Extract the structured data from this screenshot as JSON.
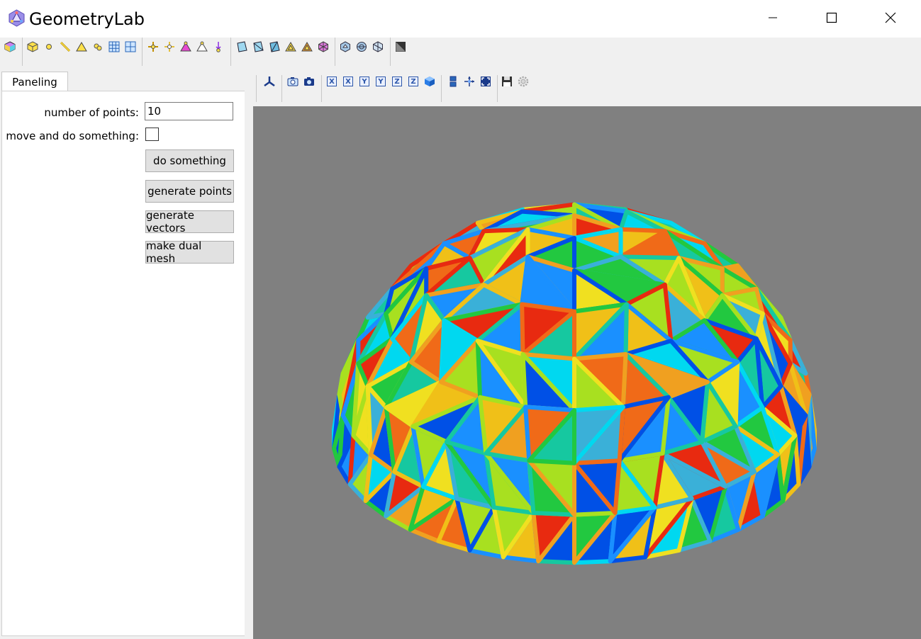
{
  "window": {
    "title": "GeometryLab",
    "controls": [
      "minimize",
      "maximize",
      "close"
    ]
  },
  "main_toolbar": {
    "groups": [
      [
        "cube-icon"
      ],
      [
        "box-icon",
        "point-icon",
        "line-icon",
        "triangle-icon",
        "circles-icon",
        "grid-icon",
        "quad-grid-icon"
      ],
      [
        "add-vertex-icon",
        "move-vertex-icon",
        "pick-triangle-icon",
        "outline-triangle-icon",
        "pin-down-icon"
      ],
      [
        "quad-face-icon",
        "quad-face-2-icon",
        "quad-face-3-icon",
        "tri-face-icon",
        "tri-face-2-icon",
        "hex-icon"
      ],
      [
        "mesh-sphere-icon",
        "mesh-sphere-2-icon",
        "mesh-sphere-3-icon"
      ],
      [
        "shading-toggle-icon"
      ]
    ]
  },
  "panel": {
    "tab_label": "Paneling",
    "number_of_points_label": "number of points:",
    "number_of_points_value": "10",
    "move_label": "move and do something:",
    "move_checked": false,
    "buttons": [
      "do something",
      "generate points",
      "generate vectors",
      "make dual mesh"
    ]
  },
  "view_toolbar": {
    "axis_buttons": [
      "X",
      "X",
      "Y",
      "Y",
      "Z",
      "Z"
    ],
    "icons": [
      "axes-icon",
      "zoom-camera-icon",
      "camera-icon",
      "view-cube-icon",
      "stack-icon",
      "pan-icon",
      "fit-view-icon",
      "save-icon",
      "settings-icon"
    ]
  },
  "colors": {
    "viewport_bg": "#808080",
    "panel_bg": "#f0f0f0",
    "button_bg": "#e1e1e1"
  }
}
